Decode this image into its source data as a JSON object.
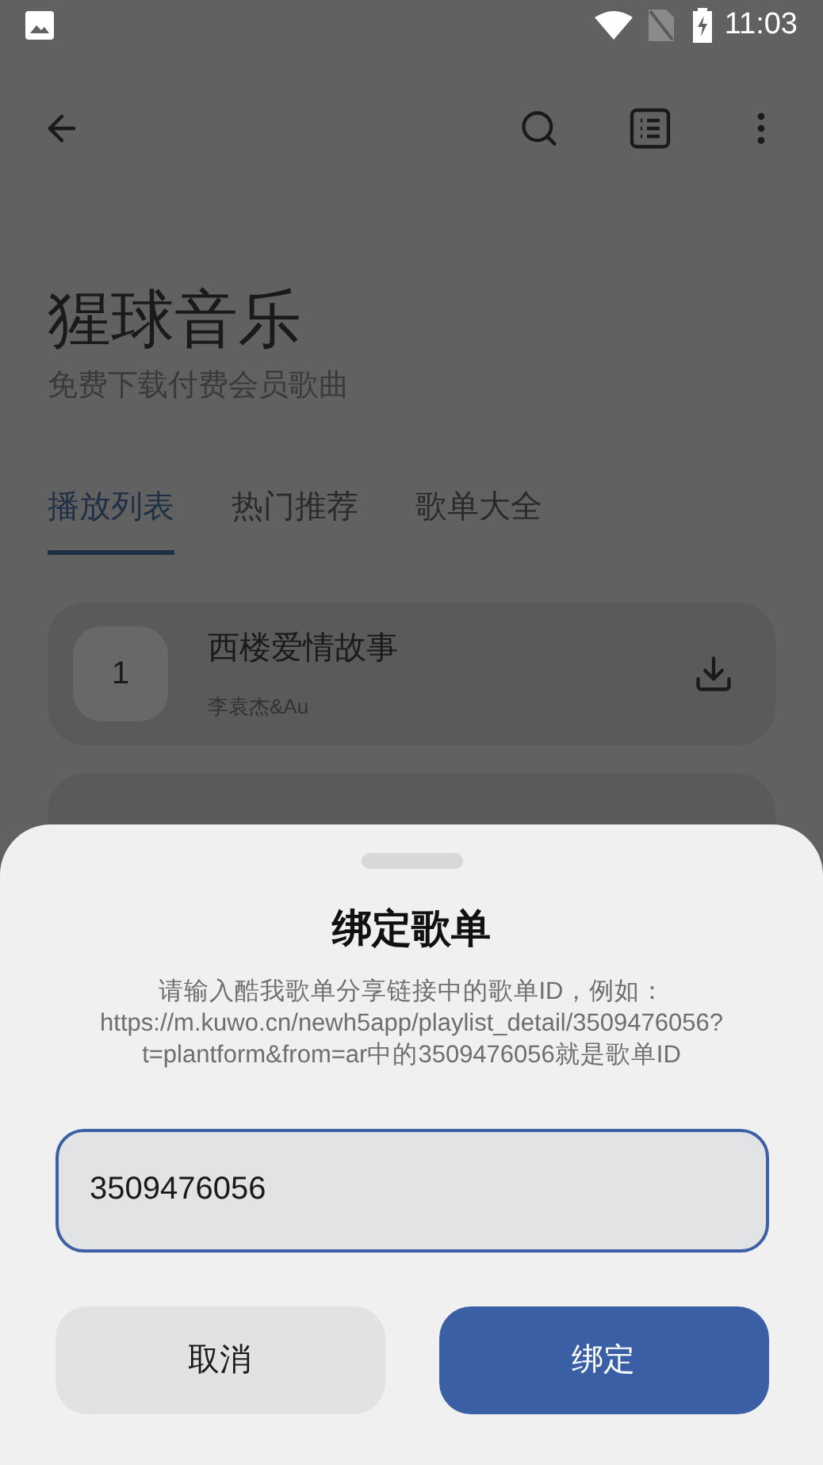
{
  "status_bar": {
    "time": "11:03"
  },
  "header": {
    "title": "猩球音乐",
    "subtitle": "免费下载付费会员歌曲"
  },
  "tabs": [
    {
      "label": "播放列表",
      "selected": true
    },
    {
      "label": "热门推荐",
      "selected": false
    },
    {
      "label": "歌单大全",
      "selected": false
    }
  ],
  "songs": [
    {
      "index": "1",
      "title": "西楼爱情故事",
      "artist": "李袁杰&Au"
    }
  ],
  "dialog": {
    "title": "绑定歌单",
    "description": "请输入酷我歌单分享链接中的歌单ID，例如：https://m.kuwo.cn/newh5app/playlist_detail/3509476056?t=plantform&from=ar中的3509476056就是歌单ID",
    "input_value": "3509476056",
    "buttons": [
      {
        "label": "取消",
        "kind": "secondary"
      },
      {
        "label": "绑定",
        "kind": "primary"
      }
    ]
  }
}
